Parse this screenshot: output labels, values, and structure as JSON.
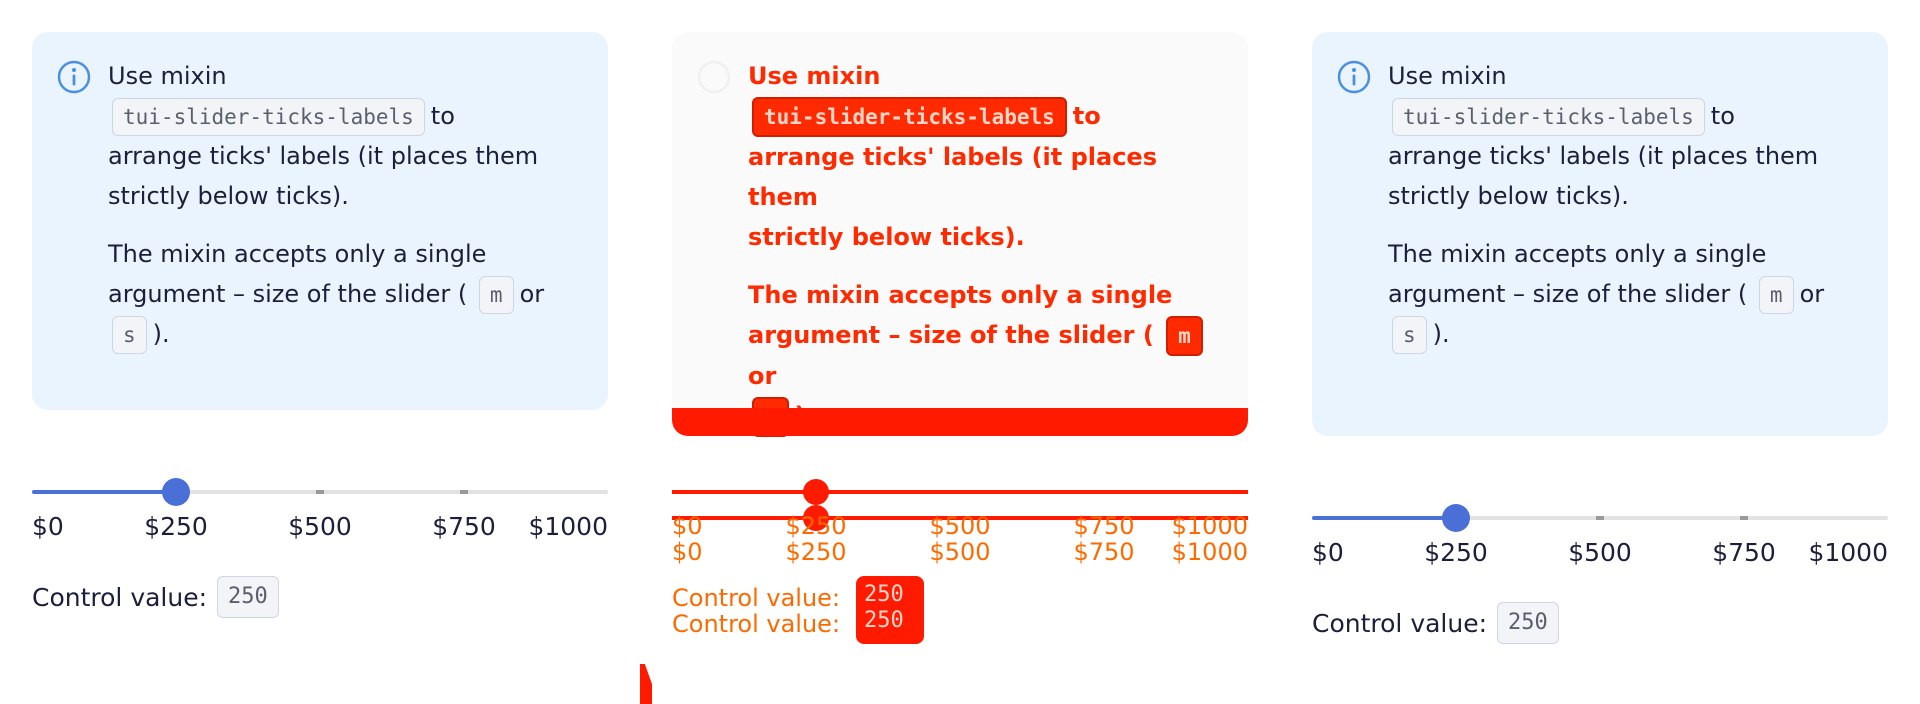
{
  "notice": {
    "line_1": "Use mixin",
    "mixin_name": "tui-slider-ticks-labels",
    "line_1_suffix": "to",
    "line_2": "arrange ticks' labels (it places them",
    "line_3": "strictly below ticks).",
    "para_2_line_1": "The mixin accepts only a single",
    "para_2_line_2": "argument – size of the slider (",
    "size_m": "m",
    "or": "or",
    "size_s": "s",
    "close": ")."
  },
  "slider": {
    "min": 0,
    "max": 1000,
    "value": 250,
    "ticks": [
      0,
      250,
      500,
      750,
      1000
    ],
    "labels": [
      "$0",
      "$250",
      "$500",
      "$750",
      "$1000"
    ],
    "accent_color": "#4a6fd6"
  },
  "control": {
    "label": "Control value:",
    "value": "250"
  },
  "diff": {
    "highlight_color": "#ff1a00"
  },
  "icons": {
    "info": "info-icon"
  }
}
